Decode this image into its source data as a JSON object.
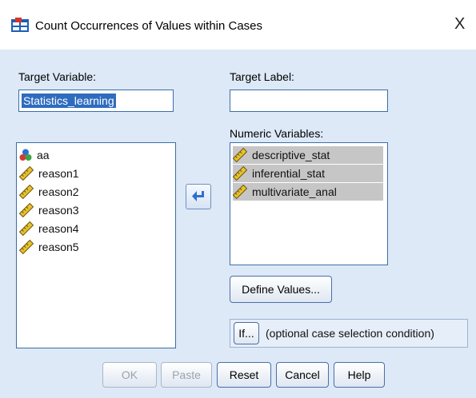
{
  "window": {
    "title": "Count Occurrences of Values within Cases",
    "close_glyph": "X",
    "app_icon": "spss-table-icon"
  },
  "target_variable": {
    "label": "Target Variable:",
    "value": "Statistics_learning"
  },
  "target_label": {
    "label": "Target Label:",
    "value": ""
  },
  "source_list": {
    "items": [
      {
        "name": "aa",
        "icon": "nominal-icon"
      },
      {
        "name": "reason1",
        "icon": "scale-ruler-icon"
      },
      {
        "name": "reason2",
        "icon": "scale-ruler-icon"
      },
      {
        "name": "reason3",
        "icon": "scale-ruler-icon"
      },
      {
        "name": "reason4",
        "icon": "scale-ruler-icon"
      },
      {
        "name": "reason5",
        "icon": "scale-ruler-icon"
      }
    ]
  },
  "numeric_variables": {
    "label": "Numeric Variables:",
    "items": [
      {
        "name": "descriptive_stat",
        "icon": "scale-ruler-icon"
      },
      {
        "name": "inferential_stat",
        "icon": "scale-ruler-icon"
      },
      {
        "name": "multivariate_anal",
        "icon": "scale-ruler-icon"
      }
    ]
  },
  "move_button": {
    "icon": "arrow-move-icon"
  },
  "define_values_button": {
    "label": "Define Values..."
  },
  "if_button": {
    "label": "If..."
  },
  "condition_text": "(optional case selection condition)",
  "buttons": {
    "ok": "OK",
    "paste": "Paste",
    "reset": "Reset",
    "cancel": "Cancel",
    "help": "Help"
  },
  "colors": {
    "dialog_bg": "#dde9f7",
    "selection_blue": "#2f6cbf",
    "list_selection_gray": "#c6c6c6",
    "arrow_blue": "#2e6fd0"
  }
}
